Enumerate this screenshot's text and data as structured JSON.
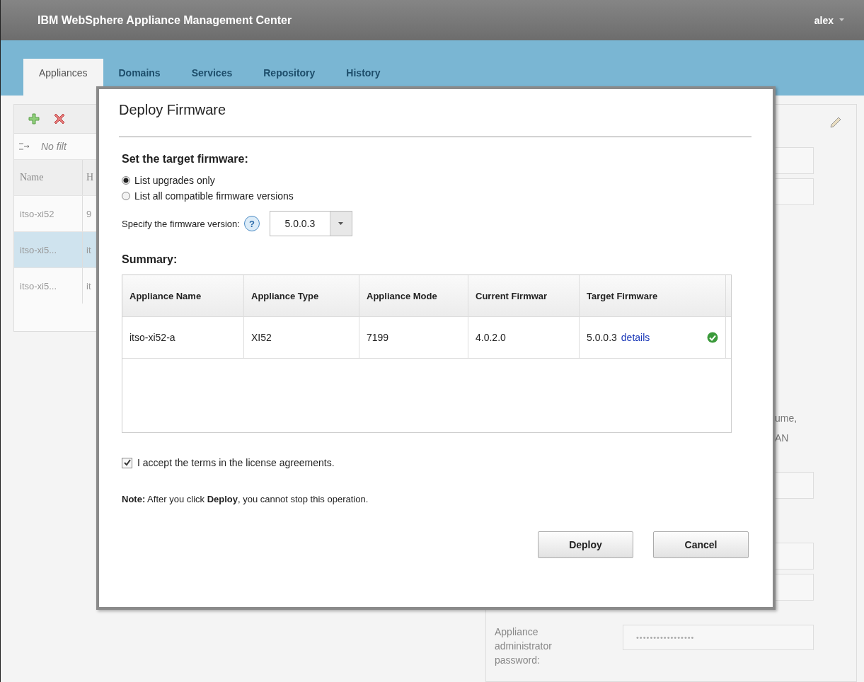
{
  "app": {
    "title": "IBM WebSphere Appliance Management Center",
    "user": "alex",
    "tabs": [
      {
        "label": "Appliances",
        "selected": true
      },
      {
        "label": "Domains",
        "selected": false
      },
      {
        "label": "Services",
        "selected": false
      },
      {
        "label": "Repository",
        "selected": false
      },
      {
        "label": "History",
        "selected": false
      }
    ],
    "list_panel": {
      "filter": "No filt",
      "columns": [
        "Name",
        "H"
      ],
      "rows": [
        {
          "cells": [
            "itso-xi52",
            "9"
          ],
          "selected": false
        },
        {
          "cells": [
            "itso-xi5...",
            "it"
          ],
          "selected": true
        },
        {
          "cells": [
            "itso-xi5...",
            "it"
          ],
          "selected": false
        }
      ]
    },
    "details_panel": {
      "fragments": [
        "ume,",
        "AN"
      ],
      "password_label": "Appliance administrator password:",
      "password_value": "•••••••••••••••••"
    }
  },
  "dialog": {
    "title": "Deploy Firmware",
    "target_heading": "Set the target firmware:",
    "options": [
      {
        "label": "List upgrades only",
        "selected": true
      },
      {
        "label": "List all compatible firmware versions",
        "selected": false
      }
    ],
    "version_label": "Specify the firmware version:",
    "help": "?",
    "version": "5.0.0.3",
    "summary_heading": "Summary:",
    "table": {
      "columns": [
        "Appliance Name",
        "Appliance Type",
        "Appliance Mode",
        "Current Firmwar",
        "Target Firmware"
      ],
      "rows": [
        {
          "cells": [
            "itso-xi52-a",
            "XI52",
            "7199",
            "4.0.2.0",
            "5.0.0.3"
          ],
          "link": "details"
        }
      ]
    },
    "license": {
      "label": "I accept the terms in the license agreements.",
      "checked": true
    },
    "note": "**Note:** After you click **Deploy**, you cannot stop this operation.",
    "buttons": [
      "Deploy",
      "Cancel"
    ]
  }
}
